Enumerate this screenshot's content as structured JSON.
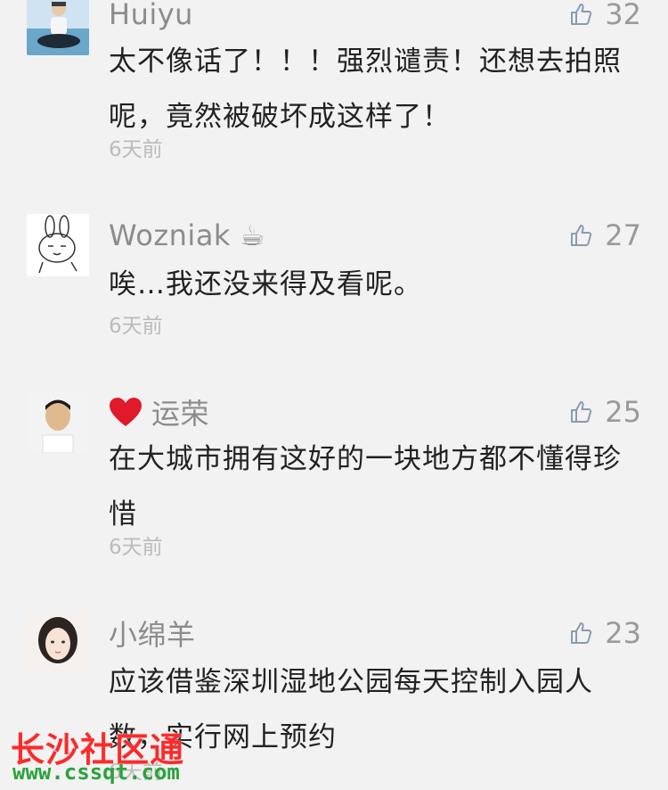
{
  "comments": [
    {
      "name": "Huiyu",
      "likes": "32",
      "text": "太不像话了！！！强烈谴责！还想去拍照呢，竟然被破坏成这样了！",
      "time": "6天前"
    },
    {
      "name": "Wozniak",
      "name_emoji": "☕",
      "likes": "27",
      "text": "唉…我还没来得及看呢。",
      "time": "6天前"
    },
    {
      "name": "运荣",
      "name_prefix_emoji": "❤️",
      "likes": "25",
      "text": "在大城市拥有这好的一块地方都不懂得珍惜",
      "time": "6天前"
    },
    {
      "name": "小绵羊",
      "likes": "23",
      "text": "应该借鉴深圳湿地公园每天控制入园人数，实行网上预约",
      "time": "6天前"
    }
  ],
  "watermark": {
    "text": "长沙社区通",
    "url": "www.cssqt.com"
  },
  "icons": {
    "like": "thumbs-up-outline-icon"
  },
  "colors": {
    "background": "#f2f2f2",
    "name": "#8c8c8c",
    "body_text": "#222222",
    "time": "#bcbcbc",
    "heart": "#e0192b",
    "watermark_red": "#ff2a2a",
    "watermark_green": "#2aa33b"
  }
}
